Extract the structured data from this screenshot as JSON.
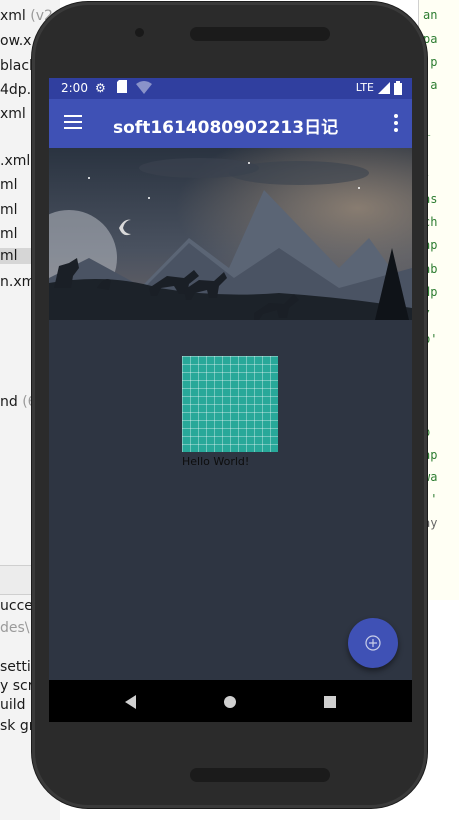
{
  "ide_left": {
    "lines": [
      {
        "text": "xml",
        "muted": " (v2"
      },
      {
        "text": "ow.x"
      },
      {
        "text": "black"
      },
      {
        "text": "4dp.x"
      },
      {
        "text": "xml"
      },
      {
        "text": ".xml"
      },
      {
        "text": "ml"
      },
      {
        "text": "ml"
      },
      {
        "text": "ml"
      },
      {
        "text": "ml"
      },
      {
        "text": "n.xm"
      },
      {
        "text": "nd",
        "muted": " (6"
      },
      {
        "text": "ucce"
      },
      {
        "text": "des\\"
      },
      {
        "text": "setti"
      },
      {
        "text": "y scri"
      },
      {
        "text": "uild"
      },
      {
        "text": "sk gra"
      }
    ]
  },
  "ide_right": {
    "lines": [
      "an",
      "pa",
      "'p",
      "'a",
      "_",
      "-",
      "as",
      "ch",
      "ap",
      "ab",
      "dp",
      "/",
      "b'",
      "p",
      "ap",
      "wa",
      "!'",
      "ay"
    ]
  },
  "status_bar": {
    "time": "2:00",
    "network": "LTE"
  },
  "app_bar": {
    "title": "soft1614080902213日记"
  },
  "content": {
    "hello_text": "Hello World!"
  },
  "colors": {
    "primary": "#3f51b5",
    "primary_dark": "#303f9f",
    "content_bg": "#2e3542",
    "grid_teal": "#28a899"
  },
  "icons": {
    "menu": "hamburger-menu-icon",
    "more": "more-vert-icon",
    "fab": "add-circle-icon",
    "nav_back": "back-triangle-icon",
    "nav_home": "home-circle-icon",
    "nav_recents": "recents-square-icon"
  }
}
